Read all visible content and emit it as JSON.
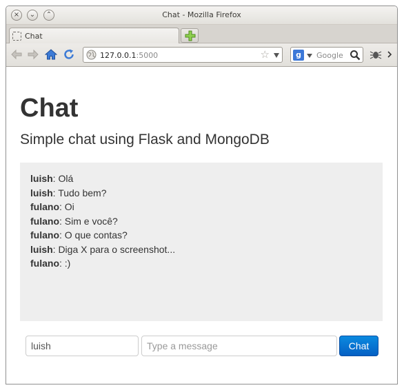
{
  "window": {
    "title": "Chat - Mozilla Firefox",
    "buttons": {
      "close": "×",
      "minimize": "⌄",
      "maximize": "⌃"
    }
  },
  "tabs": [
    {
      "label": "Chat",
      "icon": "blank-page-icon"
    }
  ],
  "navbar": {
    "url_host": "127.0.0.1",
    "url_port": ":5000",
    "search_placeholder": "Google",
    "search_engine_icon": "g",
    "star_glyph": "☆"
  },
  "page": {
    "title": "Chat",
    "subtitle": "Simple chat using Flask and MongoDB"
  },
  "messages": [
    {
      "user": "luish",
      "text": ": Olá"
    },
    {
      "user": "luish",
      "text": ": Tudo bem?"
    },
    {
      "user": "fulano",
      "text": ": Oi"
    },
    {
      "user": "fulano",
      "text": ": Sim e você?"
    },
    {
      "user": "fulano",
      "text": ": O que contas?"
    },
    {
      "user": "luish",
      "text": ": Diga X para o screenshot..."
    },
    {
      "user": "fulano",
      "text": ": :)"
    }
  ],
  "form": {
    "name_value": "luish",
    "message_placeholder": "Type a message",
    "send_label": "Chat"
  },
  "colors": {
    "accent": "#0560c4",
    "chat_background": "#eeeeee",
    "text": "#333333"
  }
}
